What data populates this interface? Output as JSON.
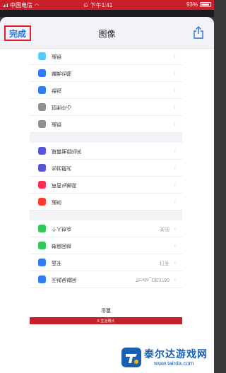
{
  "status_bar": {
    "carrier": "中国电信",
    "time": "下午1:41",
    "battery": "93%",
    "battery_level": 0.93
  },
  "sheet": {
    "done_label": "完成",
    "title": "图像",
    "share_icon": "share-icon"
  },
  "groups": [
    {
      "rows": [
        {
          "label": "通用",
          "color": "#5ac8fa",
          "value": ""
        },
        {
          "label": "辅助功能",
          "color": "#2f7cf6",
          "value": ""
        },
        {
          "label": "墙纸",
          "color": "#2f7cf6",
          "value": ""
        },
        {
          "label": "控制中心",
          "color": "#8e8e93",
          "value": ""
        },
        {
          "label": "通用",
          "color": "#8e8e93",
          "value": ""
        }
      ]
    },
    {
      "rows": [
        {
          "label": "屏幕使用时间",
          "color": "#5856d6",
          "value": ""
        },
        {
          "label": "勿扰模式",
          "color": "#5856d6",
          "value": ""
        },
        {
          "label": "声音与触感",
          "color": "#ff2d55",
          "value": ""
        },
        {
          "label": "通知",
          "color": "#ff3b30",
          "value": ""
        }
      ]
    },
    {
      "rows": [
        {
          "label": "个人热点",
          "color": "#34c759",
          "value": "关闭"
        },
        {
          "label": "蜂窝网络",
          "color": "#34c759",
          "value": ""
        },
        {
          "label": "蓝牙",
          "color": "#2f7cf6",
          "value": "打开"
        },
        {
          "label": "无线局域网",
          "color": "#2f7cf6",
          "value": "Tenda_DE3780"
        }
      ]
    }
  ],
  "footer": {
    "label": "设置",
    "bar_text": "© 生活照片"
  },
  "watermark": {
    "name": "泰尔达游戏网",
    "url": "www.tairda.com"
  }
}
